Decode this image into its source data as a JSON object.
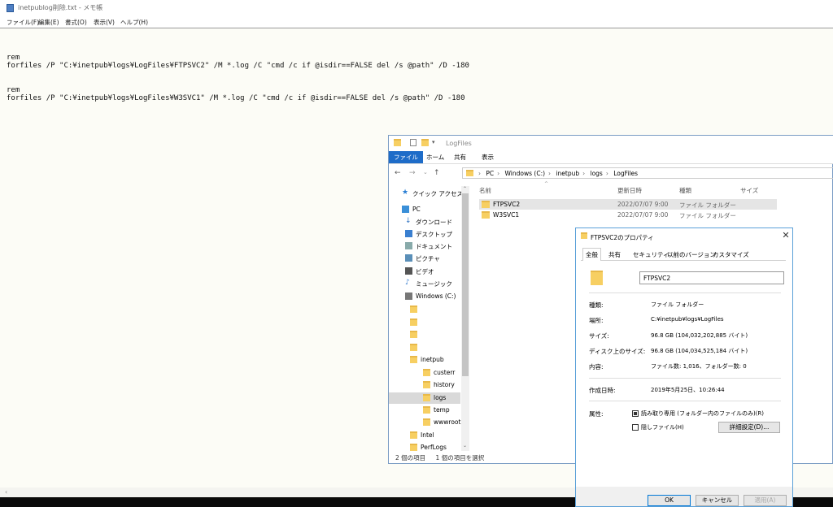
{
  "notepad": {
    "title": "inetpublog削除.txt - メモ帳",
    "menu": [
      "ファイル(F)",
      "編集(E)",
      "書式(O)",
      "表示(V)",
      "ヘルプ(H)"
    ],
    "lines": [
      "rem",
      "forfiles /P \"C:¥inetpub¥logs¥LogFiles¥FTPSVC2\" /M *.log /C \"cmd /c if @isdir==FALSE del /s @path\" /D -180",
      "",
      "",
      "rem",
      "forfiles /P \"C:¥inetpub¥logs¥LogFiles¥W3SVC1\" /M *.log /C \"cmd /c if @isdir==FALSE del /s @path\" /D -180"
    ]
  },
  "explorer": {
    "title": "LogFiles",
    "ribbon_tabs": [
      "ファイル",
      "ホーム",
      "共有",
      "表示"
    ],
    "breadcrumb": [
      "PC",
      "Windows (C:)",
      "inetpub",
      "logs",
      "LogFiles"
    ],
    "nav_items": [
      {
        "label": "クイック アクセス",
        "icon": "star-icon"
      },
      {
        "label": "PC",
        "icon": "computer-icon"
      },
      {
        "label": "ダウンロード",
        "icon": "download-icon"
      },
      {
        "label": "デスクトップ",
        "icon": "desktop-icon"
      },
      {
        "label": "ドキュメント",
        "icon": "document-icon"
      },
      {
        "label": "ピクチャ",
        "icon": "picture-icon"
      },
      {
        "label": "ビデオ",
        "icon": "video-icon"
      },
      {
        "label": "ミュージック",
        "icon": "music-icon"
      },
      {
        "label": "Windows (C:)",
        "icon": "drive-icon"
      },
      {
        "label": "",
        "icon": "folder-icon"
      },
      {
        "label": "",
        "icon": "folder-icon"
      },
      {
        "label": "",
        "icon": "folder-icon"
      },
      {
        "label": "",
        "icon": "folder-icon"
      },
      {
        "label": "inetpub",
        "icon": "folder-icon"
      },
      {
        "label": "custerr",
        "icon": "folder-icon"
      },
      {
        "label": "history",
        "icon": "folder-icon"
      },
      {
        "label": "logs",
        "icon": "folder-icon"
      },
      {
        "label": "temp",
        "icon": "folder-icon"
      },
      {
        "label": "wwwroot",
        "icon": "folder-icon"
      },
      {
        "label": "Intel",
        "icon": "folder-icon"
      },
      {
        "label": "PerfLogs",
        "icon": "folder-icon"
      }
    ],
    "columns": [
      "名前",
      "更新日時",
      "種類",
      "サイズ"
    ],
    "rows": [
      {
        "name": "FTPSVC2",
        "date": "2022/07/07 9:00",
        "type": "ファイル フォルダー"
      },
      {
        "name": "W3SVC1",
        "date": "2022/07/07 9:00",
        "type": "ファイル フォルダー"
      }
    ],
    "status": {
      "count": "2 個の項目",
      "selected": "1 個の項目を選択"
    }
  },
  "properties": {
    "title": "FTPSVC2のプロパティ",
    "tabs": [
      "全般",
      "共有",
      "セキュリティ",
      "以前のバージョン",
      "カスタマイズ"
    ],
    "name": "FTPSVC2",
    "fields": [
      {
        "label": "種類:",
        "value": "ファイル フォルダー"
      },
      {
        "label": "場所:",
        "value": "C:¥inetpub¥logs¥LogFiles"
      },
      {
        "label": "サイズ:",
        "value": "96.8 GB (104,032,202,885 バイト)"
      },
      {
        "label": "ディスク上のサイズ:",
        "value": "96.8 GB (104,034,525,184 バイト)"
      },
      {
        "label": "内容:",
        "value": "ファイル数: 1,016、フォルダー数: 0"
      }
    ],
    "created_label": "作成日時:",
    "created_value": "2019年5月25日、10:26:44",
    "attr_label": "属性:",
    "readonly_label": "読み取り専用 (フォルダー内のファイルのみ)(R)",
    "hidden_label": "隠しファイル(H)",
    "advanced_button": "詳細設定(D)...",
    "ok": "OK",
    "cancel": "キャンセル",
    "apply": "適用(A)"
  }
}
